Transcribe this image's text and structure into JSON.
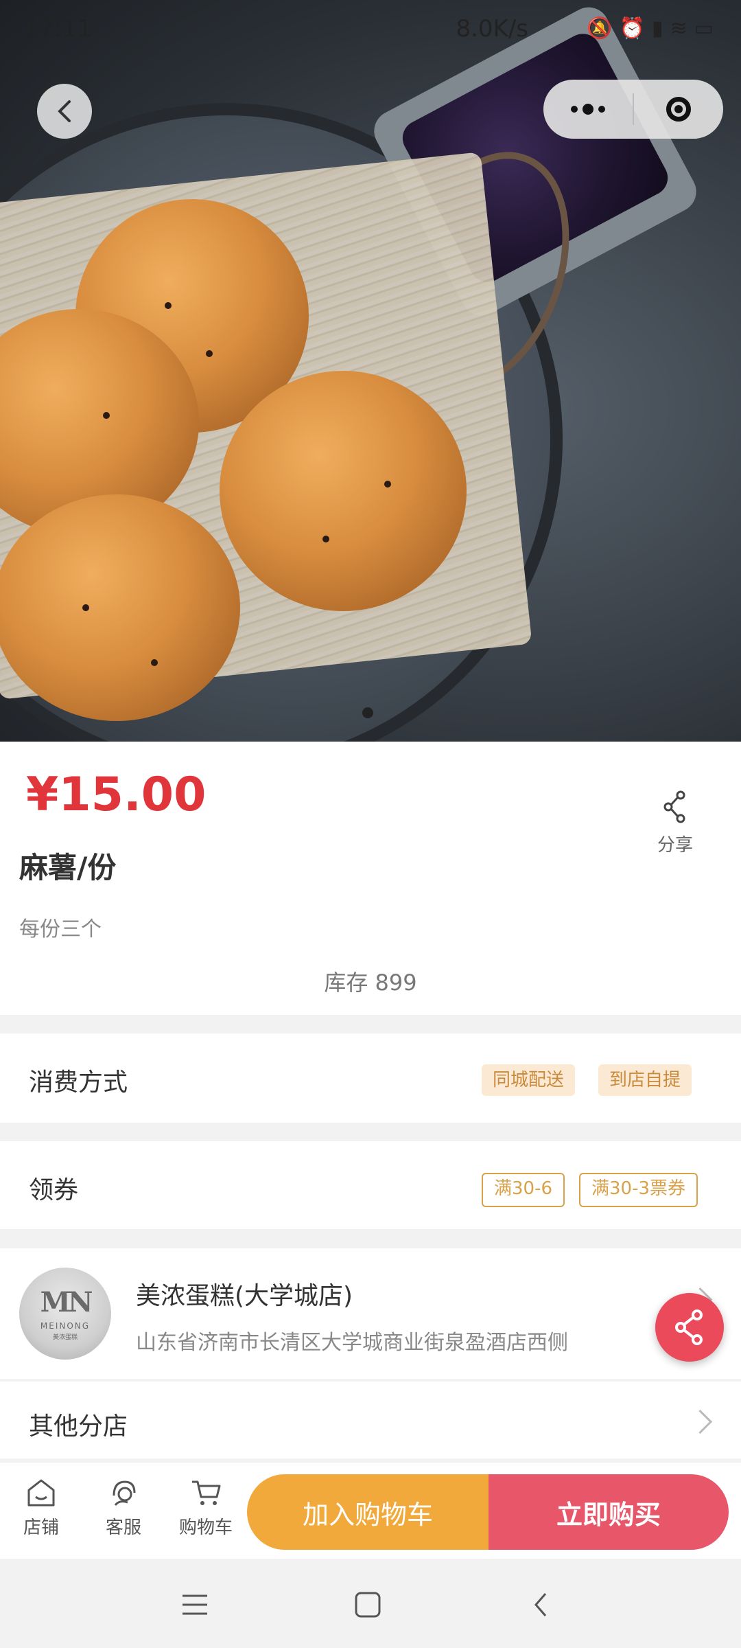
{
  "status_bar": {
    "time": "17:11",
    "network_speed": "8.0K/s",
    "icons": [
      "mute-icon",
      "alarm-icon",
      "signal-icon",
      "wifi-icon",
      "battery-icon"
    ]
  },
  "product": {
    "price": "¥15.00",
    "title": "麻薯/份",
    "description": "每份三个",
    "stock": "库存 899",
    "share_label": "分享",
    "image_indicator_count": 1
  },
  "consumption": {
    "label": "消费方式",
    "tags": [
      "同城配送",
      "到店自提"
    ]
  },
  "coupons": {
    "label": "领券",
    "tags": [
      "满30-6",
      "满30-3票券"
    ]
  },
  "store": {
    "name": "美浓蛋糕(大学城店)",
    "address": "山东省济南市长清区大学城商业街泉盈酒店西侧",
    "logo_text": "MEINONG",
    "logo_mark": "MN",
    "logo_sub": "美浓蛋糕"
  },
  "other_stores": {
    "label": "其他分店"
  },
  "bottom_bar": {
    "tabs": [
      {
        "label": "店铺",
        "icon": "store-icon"
      },
      {
        "label": "客服",
        "icon": "customer-service-icon"
      },
      {
        "label": "购物车",
        "icon": "cart-icon"
      }
    ],
    "add_to_cart": "加入购物车",
    "buy_now": "立即购买"
  },
  "colors": {
    "price": "#e0353b",
    "cart_button": "#f2a93b",
    "buy_button": "#e8566a",
    "float_share": "#ea4a5a"
  }
}
